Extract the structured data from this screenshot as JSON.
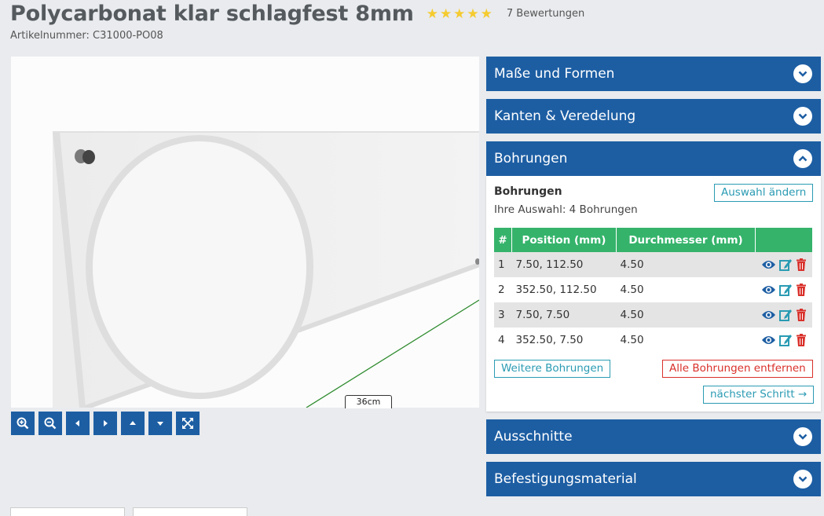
{
  "product": {
    "title": "Polycarbonat klar schlagfest 8mm",
    "stars": "★★★★★",
    "rating": 5,
    "reviews": "7 Bewertungen",
    "article_number": "Artikelnummer: C31000-PO08"
  },
  "viewer": {
    "dimension_label": "36cm",
    "toolbar": [
      "zoom-in-icon",
      "zoom-out-icon",
      "arrow-left-icon",
      "arrow-right-icon",
      "arrow-up-icon",
      "arrow-down-icon",
      "fit-to-screen-icon"
    ]
  },
  "accordion": {
    "sections": [
      {
        "label": "Maße und Formen",
        "open": false
      },
      {
        "label": "Kanten & Veredelung",
        "open": false
      },
      {
        "label": "Bohrungen",
        "open": true
      },
      {
        "label": "Ausschnitte",
        "open": false
      },
      {
        "label": "Befestigungsmaterial",
        "open": false
      }
    ],
    "bohrungen": {
      "heading": "Bohrungen",
      "selection": "Ihre Auswahl: 4 Bohrungen",
      "change_button": "Auswahl ändern",
      "columns": [
        "#",
        "Position (mm)",
        "Durchmesser (mm)",
        ""
      ],
      "rows": [
        {
          "n": "1",
          "position": "7.50, 112.50",
          "diameter": "4.50"
        },
        {
          "n": "2",
          "position": "352.50, 112.50",
          "diameter": "4.50"
        },
        {
          "n": "3",
          "position": "7.50, 7.50",
          "diameter": "4.50"
        },
        {
          "n": "4",
          "position": "352.50, 7.50",
          "diameter": "4.50"
        }
      ],
      "more_button": "Weitere Bohrungen",
      "remove_all_button": "Alle Bohrungen entfernen",
      "next_button": "nächster Schritt →"
    }
  },
  "colors": {
    "accent_blue": "#1d5ea3",
    "table_header_green": "#35b36b",
    "teal": "#2a9bb3",
    "red": "#d9302a",
    "star_yellow": "#f5cb2f"
  }
}
